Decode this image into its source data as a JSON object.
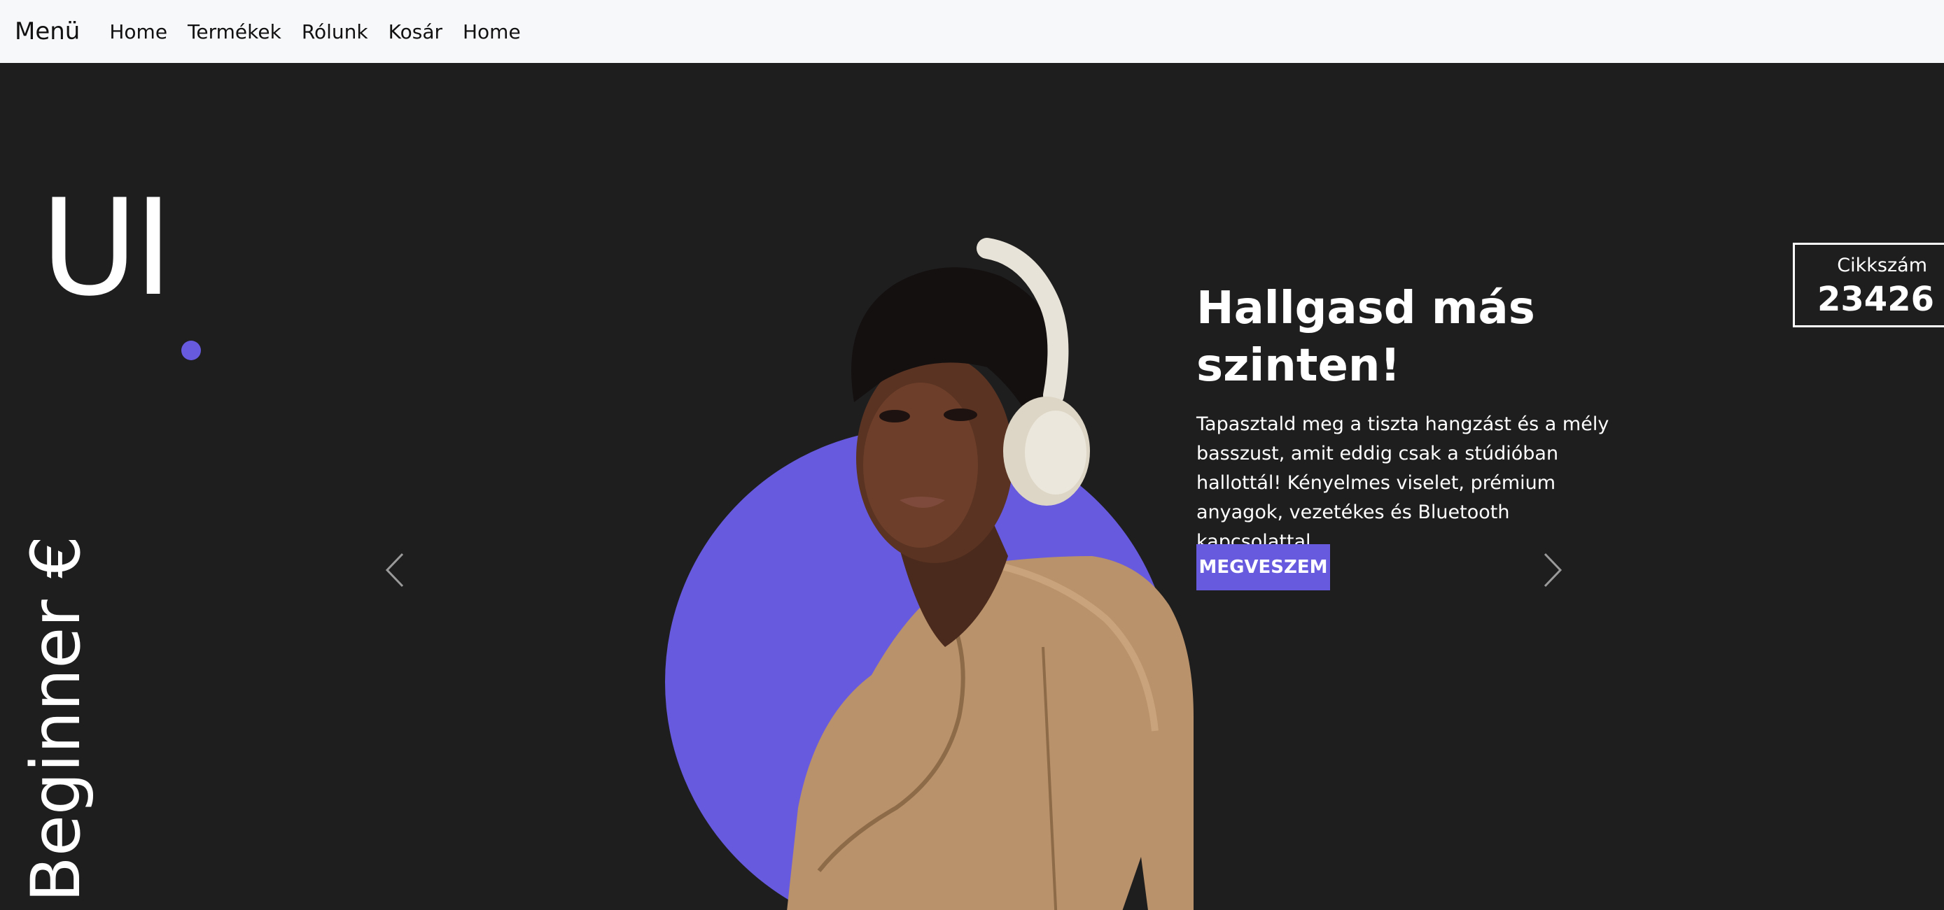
{
  "navbar": {
    "brand": "Menü",
    "links": [
      "Home",
      "Termékek",
      "Rólunk",
      "Kosár",
      "Home"
    ]
  },
  "hero": {
    "logo_text": "UI",
    "vertical_label": "Beginner €",
    "headline": "Hallgasd más szinten!",
    "description": "Tapasztald meg a tiszta hangzást és a mély basszust, amit eddig csak a stúdióban hallottál! Kényelmes viselet, prémium anyagok, vezetékes és Bluetooth kapcsolattal.",
    "buy_button": "MEGVESZEM",
    "sku_label": "Cikkszám",
    "sku_value": "23426"
  },
  "icons": {
    "prev": "chevron-left-icon",
    "next": "chevron-right-icon"
  },
  "colors": {
    "accent": "#675ade",
    "background": "#1e1e1f",
    "navbar": "#f7f8fa"
  }
}
